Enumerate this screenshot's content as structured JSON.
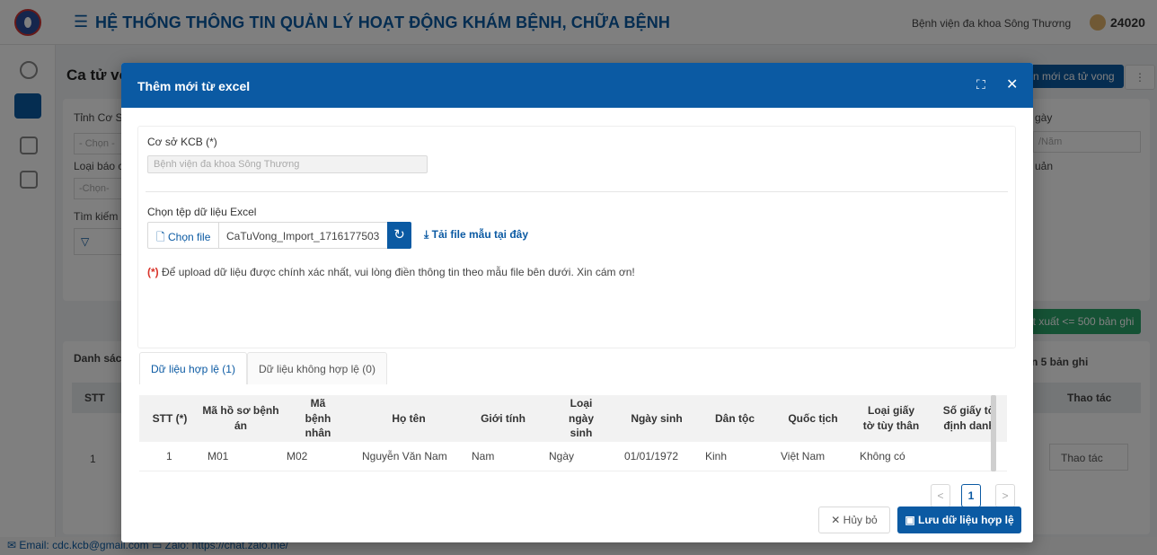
{
  "app": {
    "system_title": "HỆ THỐNG THÔNG TIN QUẢN LÝ HOẠT ĐỘNG KHÁM BỆNH, CHỮA BỆNH",
    "hospital_name": "Bệnh viện đa khoa Sông Thương",
    "user_id": "24020",
    "page_title": "Ca tử vo",
    "add_button": "n mới ca tử vong",
    "filters": {
      "label_1": "Tỉnh Cơ S",
      "select_1": "- Chọn -",
      "label_2": "Loại báo c",
      "select_2": "-Chọn-",
      "label_3": "Tìm kiếm",
      "date_label": "gày",
      "date_placeholder": "/Năm",
      "label_4": "uản"
    },
    "export_button": "ết xuất <= 500 bản ghi",
    "list_title": "Danh sách",
    "list_paging": "n 5 bản ghi",
    "table_header_stt": "STT",
    "table_header_action": "Thao tác",
    "row_number": "1",
    "row_action": "Thao tác",
    "footer_text": "✉ Email: cdc.kcb@gmail.com  ▭ Zalo: https://chat.zalo.me/"
  },
  "modal": {
    "title": "Thêm mới từ excel",
    "facility_label": "Cơ sở KCB (*)",
    "facility_value": "Bệnh viện đa khoa Sông Thương",
    "file_label": "Chọn tệp dữ liệu Excel",
    "choose_file_button": "Chọn file",
    "file_name": "CaTuVong_Import_1716177503",
    "download_template": "Tải file mẫu tại đây",
    "note_marker": "(*)",
    "note": "Để upload dữ liệu được chính xác nhất, vui lòng điền thông tin theo mẫu file bên dưới. Xin cám ơn!",
    "tabs": [
      {
        "label": "Dữ liệu hợp lệ (1)"
      },
      {
        "label": "Dữ liệu không hợp lệ (0)"
      }
    ],
    "table": {
      "headers": [
        "STT (*)",
        "Mã hồ sơ bệnh án",
        "Mã bệnh nhân",
        "Họ tên",
        "Giới tính",
        "Loại ngày sinh",
        "Ngày sinh",
        "Dân tộc",
        "Quốc tịch",
        "Loại giấy tờ tùy thân",
        "Số giấy tờ định danh"
      ],
      "rows": [
        [
          "1",
          "M01",
          "M02",
          "Nguyễn Văn Nam",
          "Nam",
          "Ngày",
          "01/01/1972",
          "Kinh",
          "Việt Nam",
          "Không có",
          ""
        ]
      ]
    },
    "pagination": {
      "prev": "<",
      "current": "1",
      "next": ">"
    },
    "cancel_button": "Hủy bỏ",
    "save_button": "Lưu dữ liệu hợp lệ"
  }
}
